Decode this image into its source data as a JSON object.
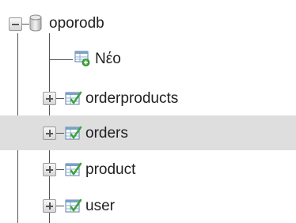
{
  "tree": {
    "database": {
      "label": "oporodb",
      "icon": "database-icon",
      "expanded": true
    },
    "new_item": {
      "label": "Νέο",
      "icon": "new-table-icon"
    },
    "tables": [
      {
        "label": "orderproducts",
        "icon": "table-icon",
        "selected": false
      },
      {
        "label": "orders",
        "icon": "table-icon",
        "selected": true
      },
      {
        "label": "product",
        "icon": "table-icon",
        "selected": false
      },
      {
        "label": "user",
        "icon": "table-icon",
        "selected": false
      }
    ]
  },
  "colors": {
    "selected_row": "#dedede",
    "text": "#222222",
    "tree_line": "#555555"
  }
}
